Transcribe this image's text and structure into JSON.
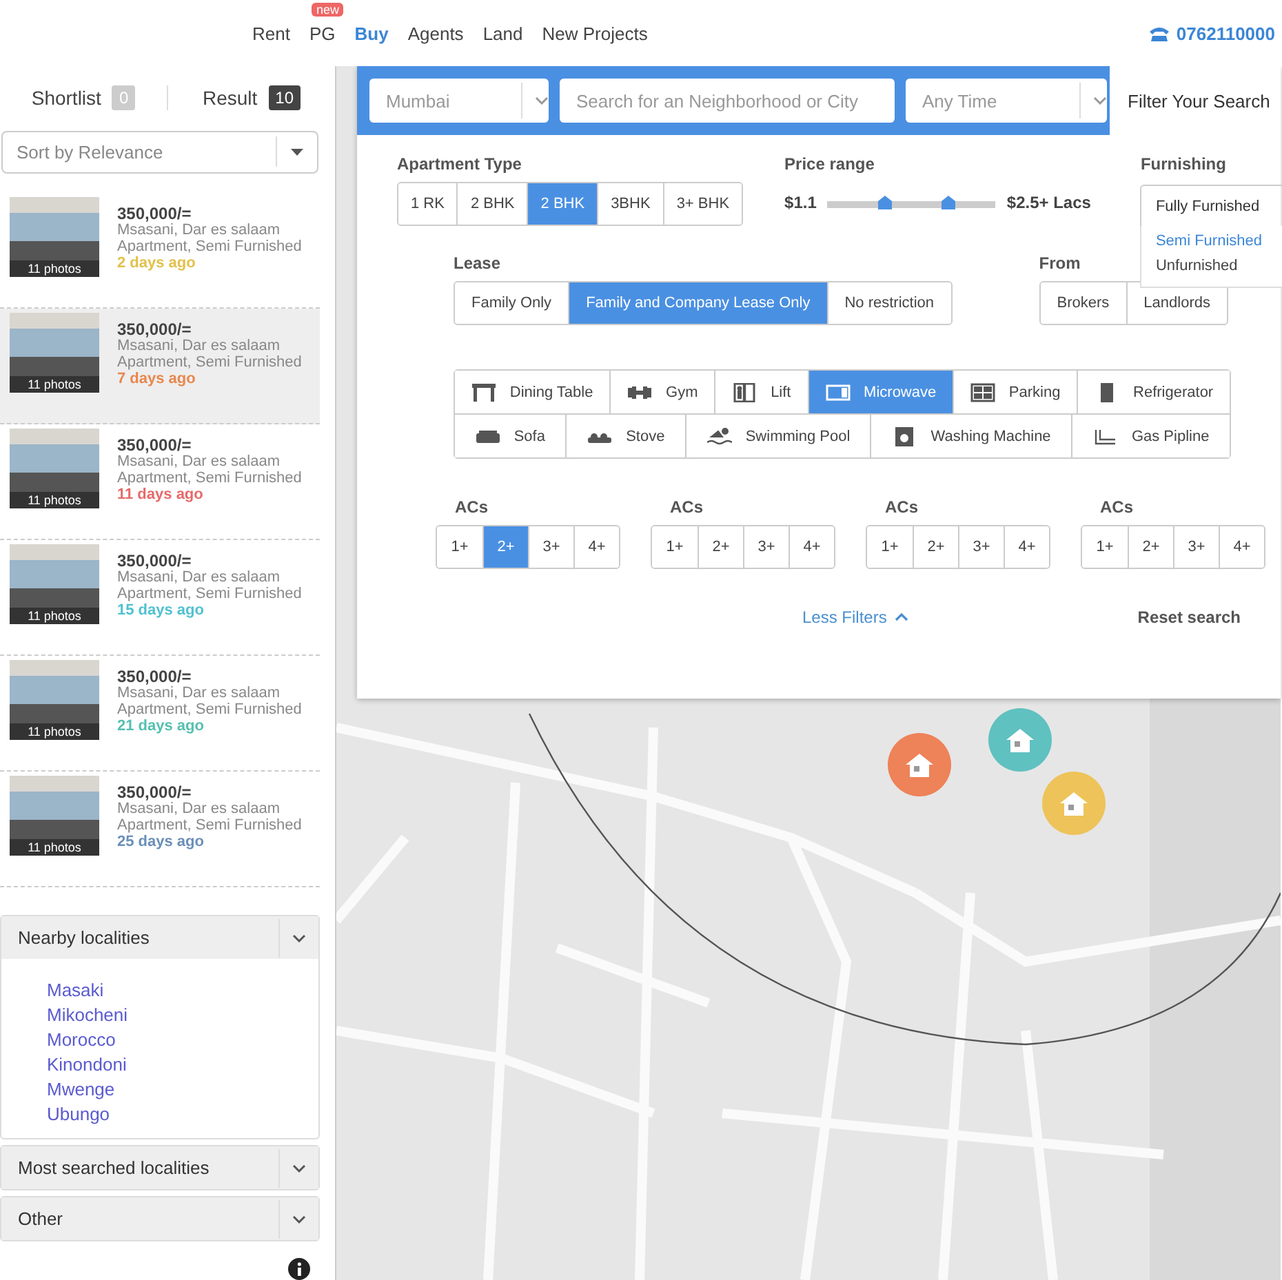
{
  "nav": {
    "items": [
      {
        "label": "Rent",
        "selected": false
      },
      {
        "label": "PG",
        "selected": false,
        "badge": "new"
      },
      {
        "label": "Buy",
        "selected": true
      },
      {
        "label": "Agents",
        "selected": false
      },
      {
        "label": "Land",
        "selected": false
      },
      {
        "label": "New Projects",
        "selected": false
      }
    ],
    "phone": "0762110000"
  },
  "sidebar": {
    "tabs": [
      {
        "label": "Shortlist",
        "count": "0",
        "selected": false
      },
      {
        "label": "Result",
        "count": "10",
        "selected": true
      }
    ],
    "sort": {
      "value": "Sort by Relevance"
    },
    "listings": [
      {
        "price": "350,000/=",
        "location": "Msasani, Dar es salaam",
        "details": "Apartment, Semi Furnished",
        "photos": "11 photos",
        "age": "2 days ago",
        "color": "#e2c14a",
        "selected": false
      },
      {
        "price": "350,000/=",
        "location": "Msasani, Dar es salaam",
        "details": "Apartment, Semi Furnished",
        "photos": "11 photos",
        "age": "7 days ago",
        "color": "#e8874e",
        "selected": true
      },
      {
        "price": "350,000/=",
        "location": "Msasani, Dar es salaam",
        "details": "Apartment, Semi Furnished",
        "photos": "11 photos",
        "age": "11 days ago",
        "color": "#e66a6a",
        "selected": false
      },
      {
        "price": "350,000/=",
        "location": "Msasani, Dar es salaam",
        "details": "Apartment, Semi Furnished",
        "photos": "11 photos",
        "age": "15 days ago",
        "color": "#4fc1d0",
        "selected": false
      },
      {
        "price": "350,000/=",
        "location": "Msasani, Dar es salaam",
        "details": "Apartment, Semi Furnished",
        "photos": "11 photos",
        "age": "21 days ago",
        "color": "#55c0b0",
        "selected": false
      },
      {
        "price": "350,000/=",
        "location": "Msasani, Dar es salaam",
        "details": "Apartment, Semi Furnished",
        "photos": "11 photos",
        "age": "25 days ago",
        "color": "#6a8fb8",
        "selected": false
      }
    ],
    "accordions": [
      {
        "title": "Nearby localities",
        "expanded": true,
        "items": [
          "Masaki",
          "Mikocheni",
          "Morocco",
          "Kinondoni",
          "Mwenge",
          "Ubungo"
        ]
      },
      {
        "title": "Most searched localities",
        "expanded": false
      },
      {
        "title": "Other",
        "expanded": false
      }
    ]
  },
  "search": {
    "city": "Mumbai",
    "placeholder": "Search for an Neighborhood or City",
    "time": "Any Time",
    "filter_tab": "Filter Your Search"
  },
  "filters": {
    "apartment_type": {
      "title": "Apartment Type",
      "options": [
        {
          "label": "1 RK",
          "selected": false
        },
        {
          "label": "2 BHK",
          "selected": false
        },
        {
          "label": "2 BHK",
          "selected": true
        },
        {
          "label": "3BHK",
          "selected": false
        },
        {
          "label": "3+ BHK",
          "selected": false
        }
      ]
    },
    "price_range": {
      "title": "Price range",
      "min_label": "$1.1",
      "max_label": "$2.5+ Lacs",
      "thumbs": [
        {
          "level": 0.34
        },
        {
          "level": 0.72
        }
      ]
    },
    "furnishing": {
      "title": "Furnishing",
      "value": "Fully Furnished",
      "options": [
        {
          "label": "Semi Furnished",
          "selected": true
        },
        {
          "label": "Unfurnished",
          "selected": false
        }
      ]
    },
    "lease": {
      "title": "Lease",
      "options": [
        {
          "label": "Family Only",
          "selected": false
        },
        {
          "label": "Family and Company Lease Only",
          "selected": true
        },
        {
          "label": "No restriction",
          "selected": false
        }
      ]
    },
    "from": {
      "title": "From",
      "options": [
        {
          "label": "Brokers",
          "selected": false
        },
        {
          "label": "Landlords",
          "selected": false
        }
      ]
    },
    "amenities": [
      [
        {
          "label": "Dining Table",
          "kind": "table",
          "selected": false
        },
        {
          "label": "Gym",
          "kind": "gym",
          "selected": false
        },
        {
          "label": "Lift",
          "kind": "lift",
          "selected": false
        },
        {
          "label": "Microwave",
          "kind": "microwave",
          "selected": true
        },
        {
          "label": "Parking",
          "kind": "parking",
          "selected": false
        },
        {
          "label": "Refrigerator",
          "kind": "fridge",
          "selected": false
        }
      ],
      [
        {
          "label": "Sofa",
          "kind": "sofa",
          "selected": false
        },
        {
          "label": "Stove",
          "kind": "stove",
          "selected": false
        },
        {
          "label": "Swimming Pool",
          "kind": "pool",
          "selected": false
        },
        {
          "label": "Washing Machine",
          "kind": "washer",
          "selected": false
        },
        {
          "label": "Gas Pipline",
          "kind": "pipe",
          "selected": false
        }
      ]
    ],
    "acs": [
      {
        "title": "ACs",
        "options": [
          {
            "label": "1+",
            "selected": false
          },
          {
            "label": "2+",
            "selected": true
          },
          {
            "label": "3+",
            "selected": false
          },
          {
            "label": "4+",
            "selected": false
          }
        ]
      },
      {
        "title": "ACs",
        "options": [
          {
            "label": "1+",
            "selected": false
          },
          {
            "label": "2+",
            "selected": false
          },
          {
            "label": "3+",
            "selected": false
          },
          {
            "label": "4+",
            "selected": false
          }
        ]
      },
      {
        "title": "ACs",
        "options": [
          {
            "label": "1+",
            "selected": false
          },
          {
            "label": "2+",
            "selected": false
          },
          {
            "label": "3+",
            "selected": false
          },
          {
            "label": "4+",
            "selected": false
          }
        ]
      },
      {
        "title": "ACs",
        "options": [
          {
            "label": "1+",
            "selected": false
          },
          {
            "label": "2+",
            "selected": false
          },
          {
            "label": "3+",
            "selected": false
          },
          {
            "label": "4+",
            "selected": false
          }
        ]
      }
    ],
    "less_filters": "Less Filters",
    "reset": "Reset search"
  },
  "map": {
    "markers": [
      {
        "color": "#ee8258"
      },
      {
        "color": "#5fc1c0"
      },
      {
        "color": "#eec35a"
      }
    ]
  }
}
